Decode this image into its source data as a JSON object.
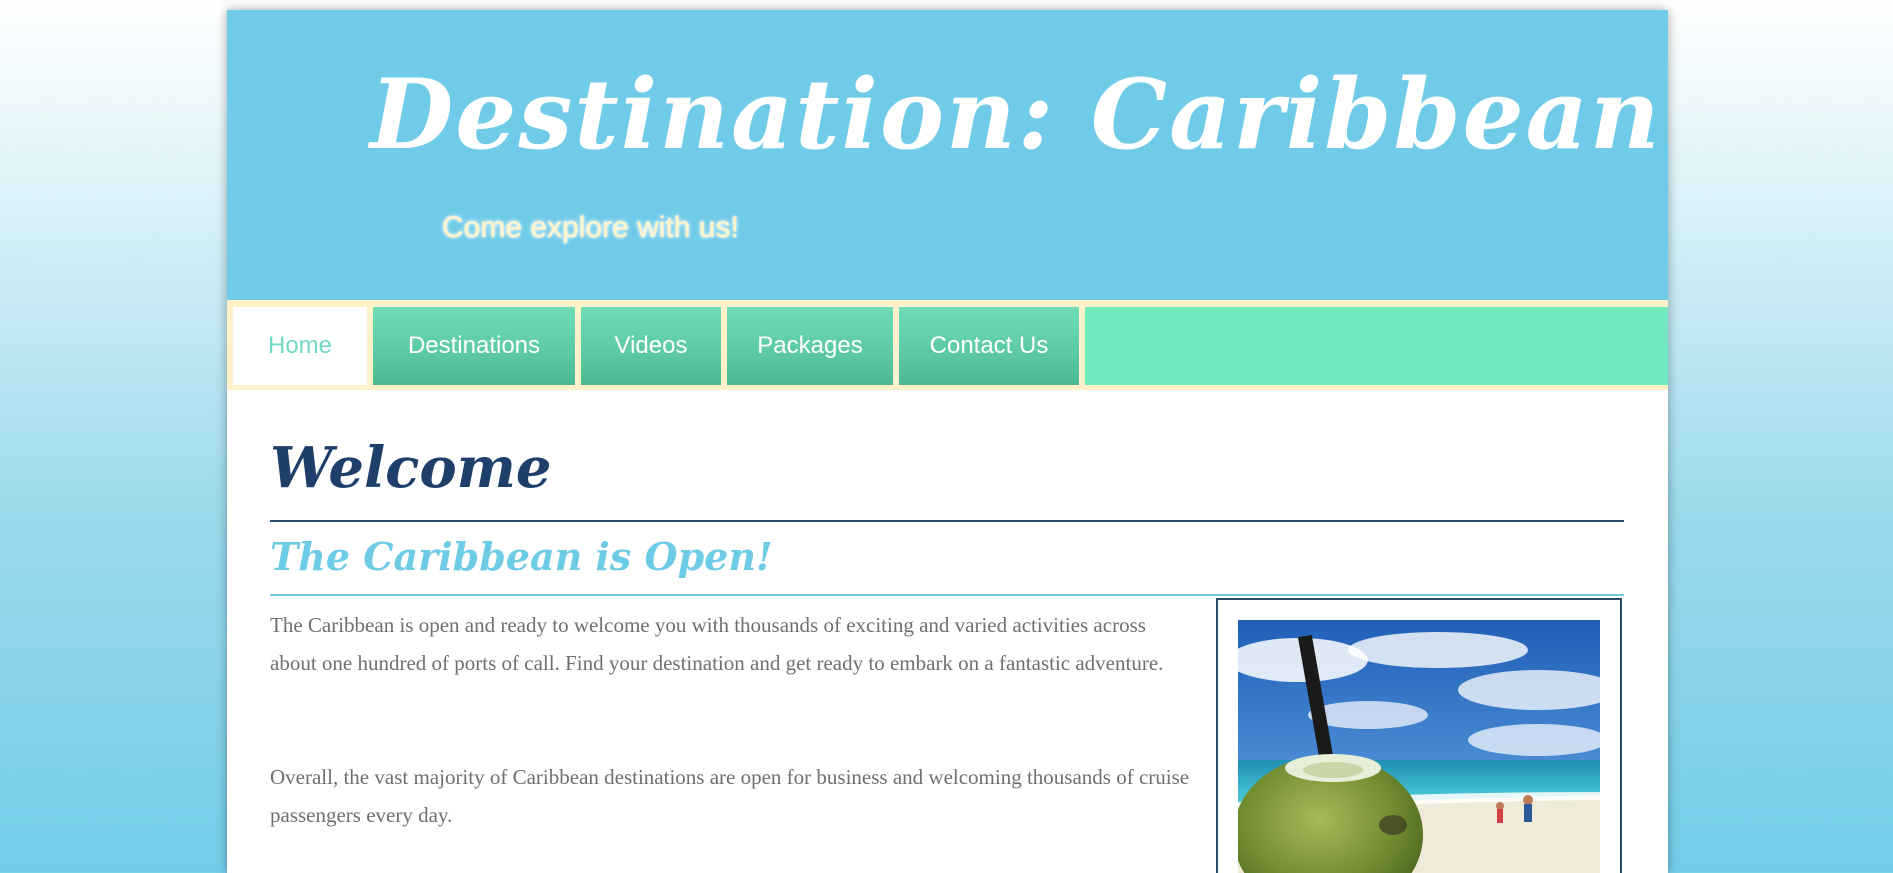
{
  "header": {
    "title": "Destination: Caribbean",
    "tagline": "Come explore with us!"
  },
  "nav": {
    "items": [
      {
        "label": "Home",
        "active": true
      },
      {
        "label": "Destinations",
        "active": false
      },
      {
        "label": "Videos",
        "active": false
      },
      {
        "label": "Packages",
        "active": false
      },
      {
        "label": "Contact Us",
        "active": false
      }
    ]
  },
  "main": {
    "heading": "Welcome",
    "subheading": "The Caribbean is Open!",
    "paragraphs": [
      "The Caribbean is open and ready to welcome you with thousands of exciting and varied activities across about one hundred of ports of call. Find your destination and get ready to embark on a fantastic adventure.",
      "Overall, the vast majority of Caribbean destinations are open for business and welcoming thousands of cruise passengers every day."
    ],
    "image": {
      "description_icon": "coconut-drink-beach-photo"
    }
  },
  "colors": {
    "header_bg": "#70cbe8",
    "nav_bg": "#72eac0",
    "nav_border": "#fff2c8",
    "heading": "#1f3f6b",
    "subheading": "#6ecbe6",
    "body_text": "#6f6f6f",
    "active_nav_text": "#72d9c5"
  }
}
